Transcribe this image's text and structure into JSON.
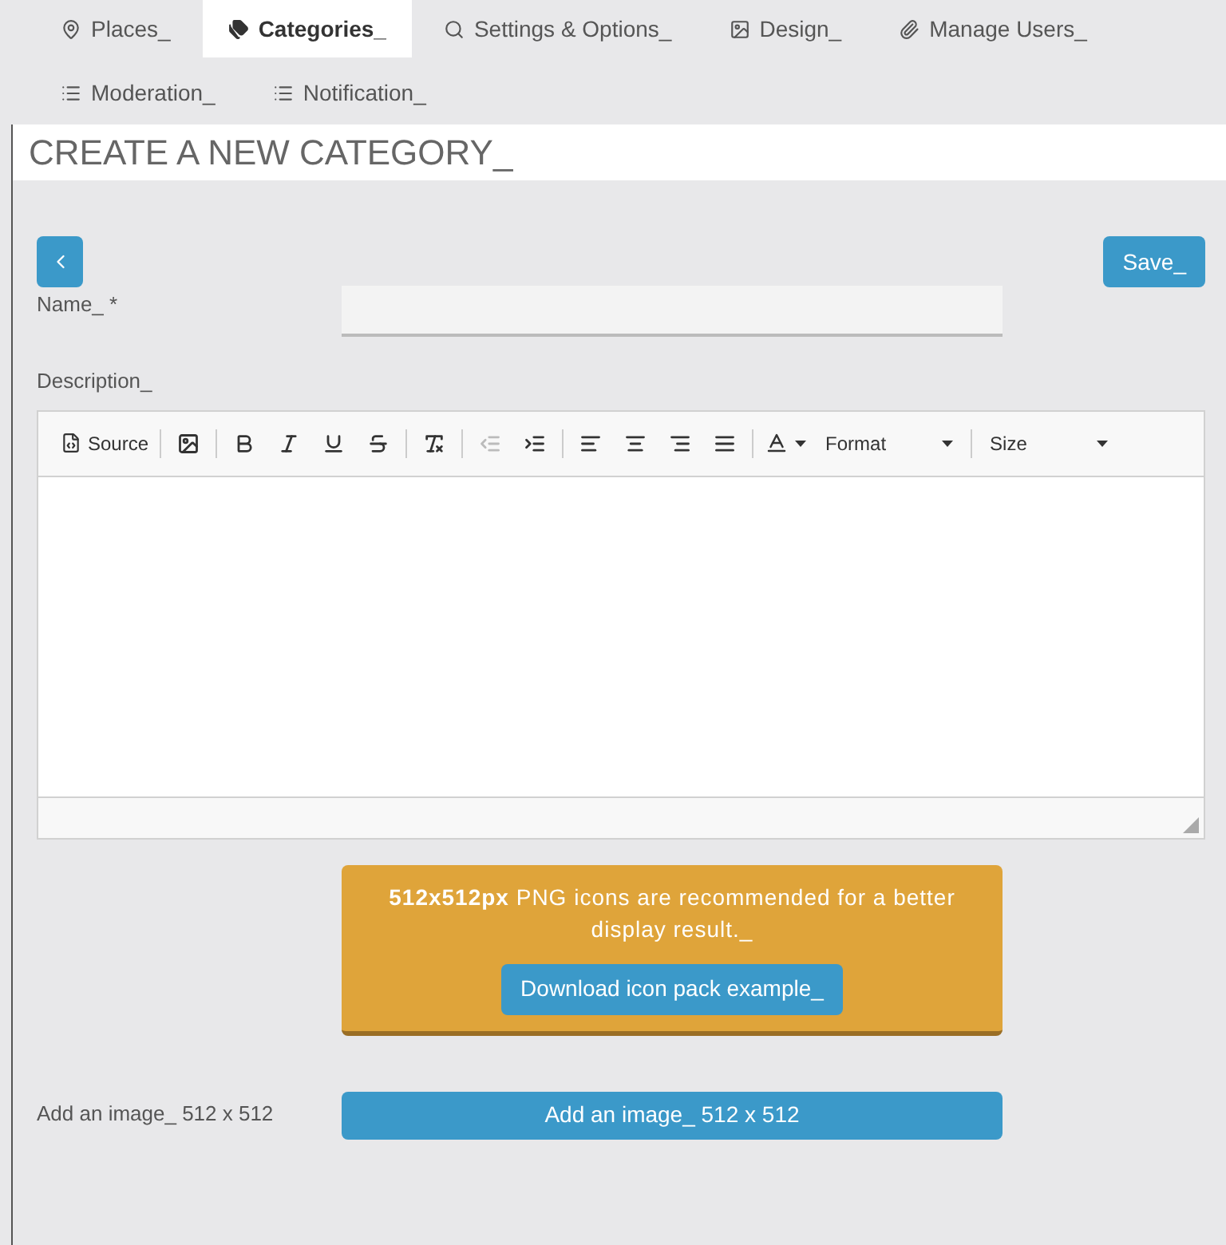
{
  "tabs": [
    {
      "label": "Places_",
      "selected": false
    },
    {
      "label": "Categories_",
      "selected": true
    },
    {
      "label": "Settings & Options_",
      "selected": false
    },
    {
      "label": "Design_",
      "selected": false
    },
    {
      "label": "Manage Users_",
      "selected": false
    },
    {
      "label": "Moderation_",
      "selected": false
    },
    {
      "label": "Notification_",
      "selected": false
    }
  ],
  "header": {
    "title": "CREATE A NEW CATEGORY_"
  },
  "save_button": "Save_",
  "name_field": {
    "label": "Name_ *"
  },
  "description": {
    "label": "Description_",
    "toolbar": [
      [
        {
          "kind": "source",
          "label": "Source",
          "disabled": false
        }
      ],
      [
        {
          "kind": "image",
          "disabled": false
        }
      ],
      [
        {
          "kind": "bold",
          "disabled": false
        },
        {
          "kind": "italic",
          "disabled": false
        },
        {
          "kind": "underline",
          "disabled": false
        },
        {
          "kind": "strike",
          "disabled": false
        }
      ],
      [
        {
          "kind": "clear",
          "disabled": false
        }
      ],
      [
        {
          "kind": "outdent",
          "disabled": true
        },
        {
          "kind": "indent",
          "disabled": false
        }
      ],
      [
        {
          "kind": "left",
          "disabled": false
        },
        {
          "kind": "center",
          "disabled": false
        },
        {
          "kind": "right",
          "disabled": false
        },
        {
          "kind": "justify",
          "disabled": false
        }
      ],
      [
        {
          "kind": "color",
          "disabled": false
        },
        {
          "kind": "dropdown",
          "label": "Format",
          "disabled": false
        }
      ],
      [
        {
          "kind": "dropdown",
          "label": "Size",
          "disabled": false
        }
      ]
    ]
  },
  "alert": {
    "text": "**512x512px** PNG icons are recommended for a better display result._",
    "button": "Download icon pack example_"
  },
  "image_field": {
    "label": "Add an image_ 512 x 512",
    "button": "Add an image_ 512 x 512"
  }
}
